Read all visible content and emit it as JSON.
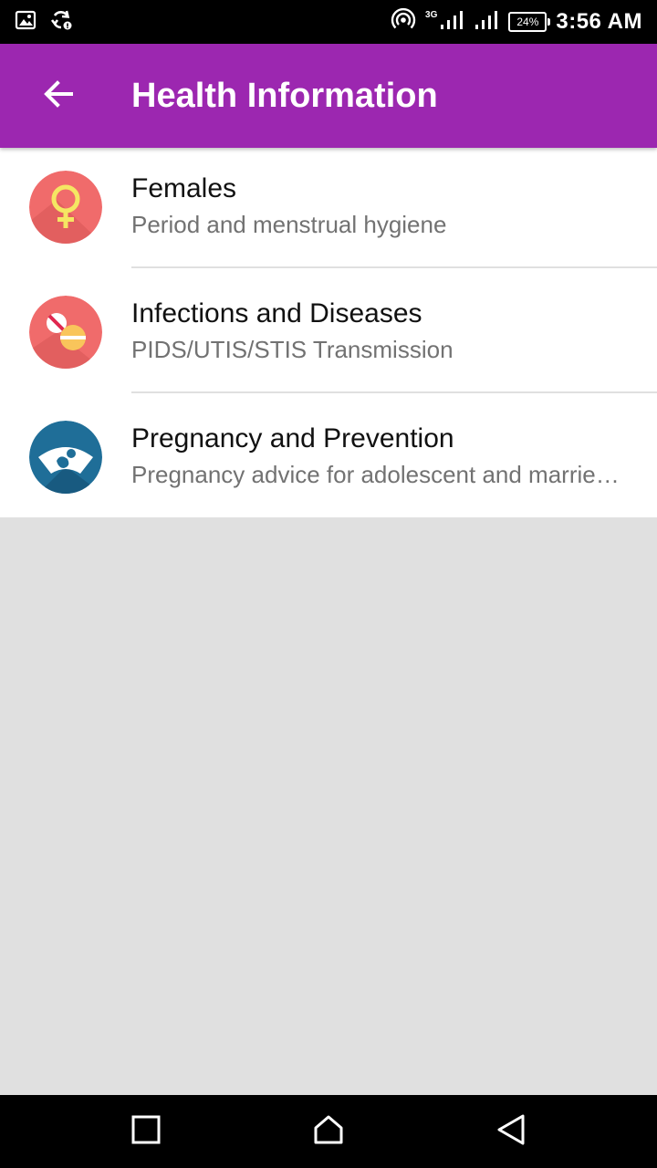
{
  "status_bar": {
    "time": "3:56 AM",
    "battery": "24%",
    "network": "3G"
  },
  "app_bar": {
    "title": "Health Information",
    "color": "#9c27b0"
  },
  "items": [
    {
      "title": "Females",
      "subtitle": "Period and menstrual hygiene",
      "icon": "female-symbol-icon",
      "icon_color": "#f06b6b"
    },
    {
      "title": "Infections and Diseases",
      "subtitle": "PIDS/UTIS/STIS Transmission",
      "icon": "pills-icon",
      "icon_color": "#f06b6b"
    },
    {
      "title": "Pregnancy and Prevention",
      "subtitle": "Pregnancy advice for adolescent and married women",
      "icon": "ultrasound-icon",
      "icon_color": "#1f6e98"
    }
  ]
}
